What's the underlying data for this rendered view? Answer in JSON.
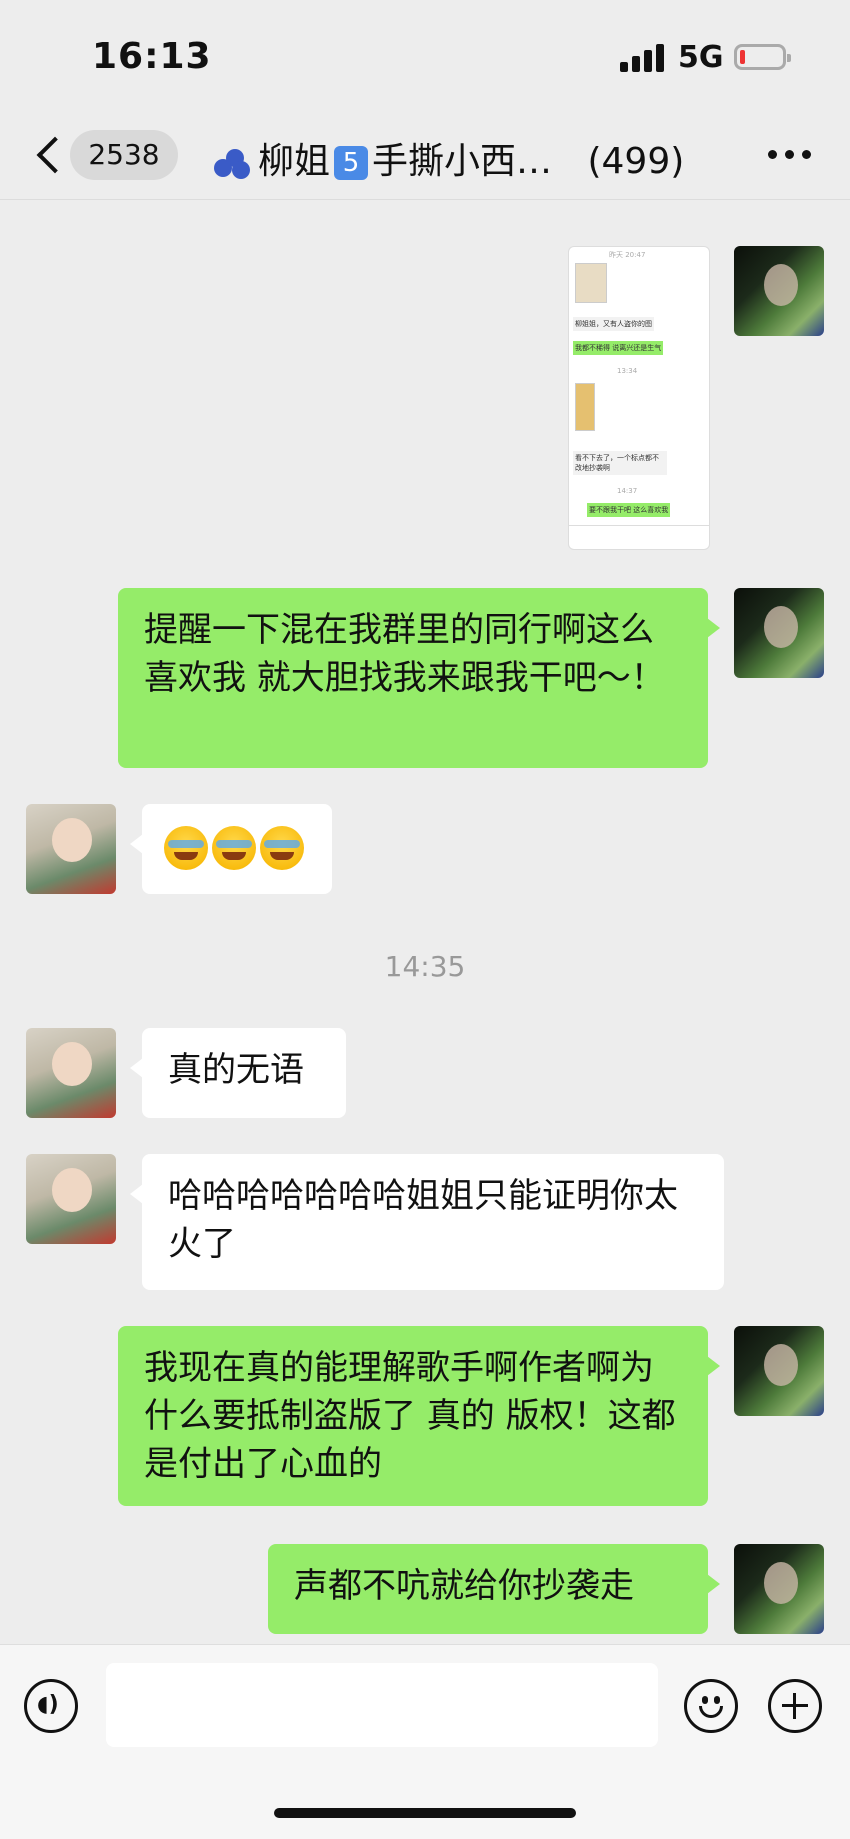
{
  "status_bar": {
    "time": "16:13",
    "network": "5G"
  },
  "nav": {
    "unread_count": "2538",
    "title_name": "柳姐",
    "title_badge": "5",
    "title_rest": "手撕小西…",
    "member_count": "(499)"
  },
  "messages": [
    {
      "sender": "me",
      "type": "image",
      "image_text": {
        "header": "昨天 20:47",
        "line1": "柳姐姐，又有人盗你的图",
        "line2": "我都不稀得 说离兴还是生气",
        "ts1": "13:34",
        "line3": "看不下去了，一个标点都不改地抄袭啊",
        "ts2": "14:37",
        "line4": "要不跟我干吧 这么喜欢我"
      }
    },
    {
      "sender": "me",
      "type": "text",
      "text": "提醒一下混在我群里的同行啊这么喜欢我 就大胆找我来跟我干吧～！"
    },
    {
      "sender": "other",
      "type": "emoji",
      "emoji": "face-with-tears-of-joy",
      "count": 3
    },
    {
      "type": "timestamp",
      "text": "14:35"
    },
    {
      "sender": "other",
      "type": "text",
      "text": "真的无语"
    },
    {
      "sender": "other",
      "type": "text",
      "text": "哈哈哈哈哈哈哈姐姐只能证明你太火了"
    },
    {
      "sender": "me",
      "type": "text",
      "text": "我现在真的能理解歌手啊作者啊为什么要抵制盗版了 真的 版权！这都是付出了心血的"
    },
    {
      "sender": "me",
      "type": "text",
      "text": "声都不吭就给你抄袭走"
    }
  ],
  "input_bar": {
    "icons": [
      "voice-icon",
      "emoji-icon",
      "plus-icon"
    ]
  },
  "colors": {
    "my_bubble": "#95ec69",
    "their_bubble": "#ffffff",
    "background": "#ededed"
  }
}
